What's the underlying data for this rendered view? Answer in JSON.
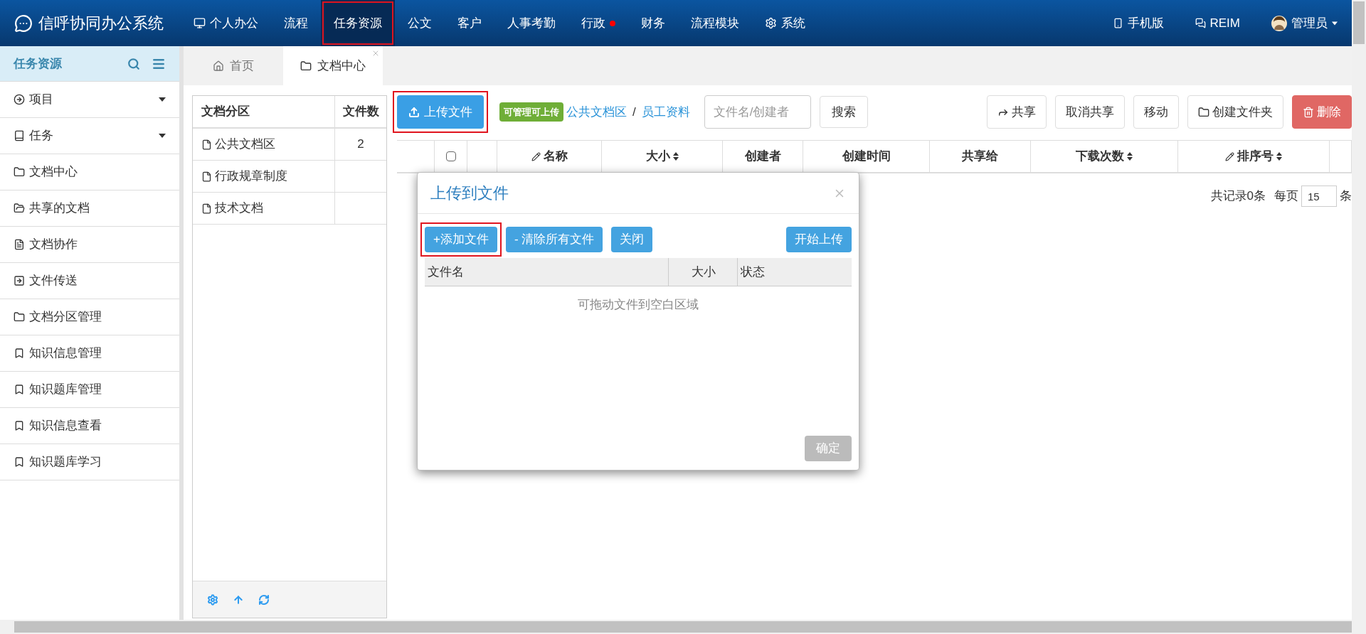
{
  "app": {
    "title": "信呼协同办公系统"
  },
  "nav": [
    {
      "label": "个人办公",
      "selected": false,
      "highlighted": false,
      "alert": false
    },
    {
      "label": "流程",
      "selected": false,
      "highlighted": false,
      "alert": false
    },
    {
      "label": "任务资源",
      "selected": true,
      "highlighted": true,
      "alert": false
    },
    {
      "label": "公文",
      "selected": false,
      "highlighted": false,
      "alert": false
    },
    {
      "label": "客户",
      "selected": false,
      "highlighted": false,
      "alert": false
    },
    {
      "label": "人事考勤",
      "selected": false,
      "highlighted": false,
      "alert": false
    },
    {
      "label": "行政",
      "selected": false,
      "highlighted": false,
      "alert": true
    },
    {
      "label": "财务",
      "selected": false,
      "highlighted": false,
      "alert": false
    },
    {
      "label": "流程模块",
      "selected": false,
      "highlighted": false,
      "alert": false
    },
    {
      "label": "系统",
      "selected": false,
      "highlighted": false,
      "alert": false
    }
  ],
  "user_menu": [
    {
      "label": "手机版"
    },
    {
      "label": "REIM"
    },
    {
      "label": "管理员",
      "dropdown": true
    }
  ],
  "sidebar": {
    "title": "任务资源",
    "items": [
      {
        "label": "项目",
        "expandable": true
      },
      {
        "label": "任务",
        "expandable": true
      },
      {
        "label": "文档中心",
        "expandable": false
      },
      {
        "label": "共享的文档",
        "expandable": false
      },
      {
        "label": "文档协作",
        "expandable": false
      },
      {
        "label": "文件传送",
        "expandable": false
      },
      {
        "label": "文档分区管理",
        "expandable": false
      },
      {
        "label": "知识信息管理",
        "expandable": false
      },
      {
        "label": "知识题库管理",
        "expandable": false
      },
      {
        "label": "知识信息查看",
        "expandable": false
      },
      {
        "label": "知识题库学习",
        "expandable": false
      }
    ]
  },
  "tabs": [
    {
      "label": "首页",
      "selected": false,
      "closable": false
    },
    {
      "label": "文档中心",
      "selected": true,
      "closable": true
    }
  ],
  "partitions": {
    "columns": [
      "文档分区",
      "文件数"
    ],
    "rows": [
      {
        "name": "公共文档区",
        "count": "2"
      },
      {
        "name": "行政规章制度"
      },
      {
        "name": "技术文档"
      }
    ]
  },
  "toolbar": {
    "upload": {
      "label": "上传文件",
      "highlighted": true
    },
    "badge": "可管理可上传",
    "breadcrumb": [
      "公共文档区",
      "员工资料"
    ],
    "separator": "/",
    "search": {
      "placeholder": "文件名/创建者"
    },
    "search_button": "搜索",
    "actions": [
      {
        "label": "共享",
        "kind": "default"
      },
      {
        "label": "取消共享",
        "kind": "default"
      },
      {
        "label": "移动",
        "kind": "default"
      },
      {
        "label": "创建文件夹",
        "kind": "default"
      },
      {
        "label": "删除",
        "kind": "danger"
      }
    ]
  },
  "file_table": {
    "columns": [
      {
        "kind": "blank"
      },
      {
        "kind": "checkbox",
        "checked": false
      },
      {
        "kind": "blank"
      },
      {
        "kind": "text",
        "label": "名称",
        "sortable": false
      },
      {
        "kind": "text",
        "label": "大小",
        "sortable": true
      },
      {
        "kind": "text",
        "label": "创建者",
        "sortable": false
      },
      {
        "kind": "text",
        "label": "创建时间",
        "sortable": false
      },
      {
        "kind": "text",
        "label": "共享给",
        "sortable": false
      },
      {
        "kind": "text",
        "label": "下载次数",
        "sortable": true
      },
      {
        "kind": "text",
        "label": "排序号",
        "sortable": true
      },
      {
        "kind": "blank"
      }
    ]
  },
  "pager": {
    "total": "共记录0条",
    "per_page_label": "每页",
    "per_page": "15",
    "unit": "条"
  },
  "modal": {
    "title": "上传到文件",
    "buttons": [
      {
        "label": "+添加文件",
        "highlighted": true
      },
      {
        "label": "- 清除所有文件",
        "highlighted": false
      },
      {
        "label": "关闭",
        "highlighted": false
      },
      {
        "label": "开始上传",
        "highlighted": false
      }
    ],
    "columns": [
      "文件名",
      "大小",
      "状态"
    ],
    "empty_hint": "可拖动文件到空白区域",
    "confirm": {
      "label": "确定",
      "disabled": true
    }
  }
}
